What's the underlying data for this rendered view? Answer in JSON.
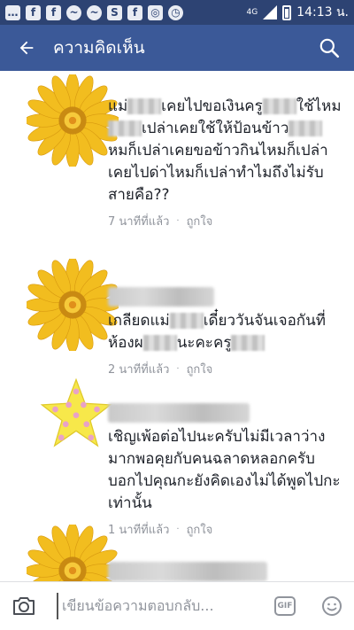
{
  "status_bar": {
    "time": "14:13 น.",
    "network": "4G",
    "notification_icons": [
      "chat-icon",
      "facebook-icon",
      "facebook-icon",
      "messenger-icon",
      "messenger-icon",
      "s-icon",
      "facebook-icon",
      "instagram-icon",
      "alarm-icon"
    ]
  },
  "header": {
    "title": "ความคิดเห็น",
    "back_icon": "back-arrow-icon",
    "search_icon": "search-icon",
    "color": "#3b5998"
  },
  "comments": [
    {
      "avatar": "sunflower",
      "text_parts": [
        "แม่",
        "เคยไปขอเงินครู",
        "ใช้ไหม",
        "เปล่าเคยใช้ให้ป้อนข้าว",
        "หมก็เปล่าเคยขอข้าวกินไหมก็เปล่าเคยไปด่าไหมก็เปล่าทำไมถึงไม่รับสายคือ??"
      ],
      "time": "7 นาทีที่แล้ว",
      "like": "ถูกใจ"
    },
    {
      "avatar": "sunflower",
      "text_parts": [
        "เกลียดแม่",
        "เดี๋ยววันจันเจอกันที่ห้องผ",
        "นะคะครู"
      ],
      "time": "2 นาทีที่แล้ว",
      "like": "ถูกใจ"
    },
    {
      "avatar": "star",
      "text_parts": [
        "เชิญเพ้อต่อไปนะครับไม่มีเวลาว่างมากพอคุยกับคนฉลาดหลอกครับ บอกไปคุณกะยังคิดเองไม่ได้พูดไปกะเท่านั้น"
      ],
      "time": "1 นาทีที่แล้ว",
      "like": "ถูกใจ"
    },
    {
      "avatar": "sunflower"
    }
  ],
  "composer": {
    "placeholder": "เขียนข้อความตอบกลับ...",
    "camera_icon": "camera-icon",
    "gif_label": "GIF",
    "emoji_icon": "emoji-icon"
  }
}
